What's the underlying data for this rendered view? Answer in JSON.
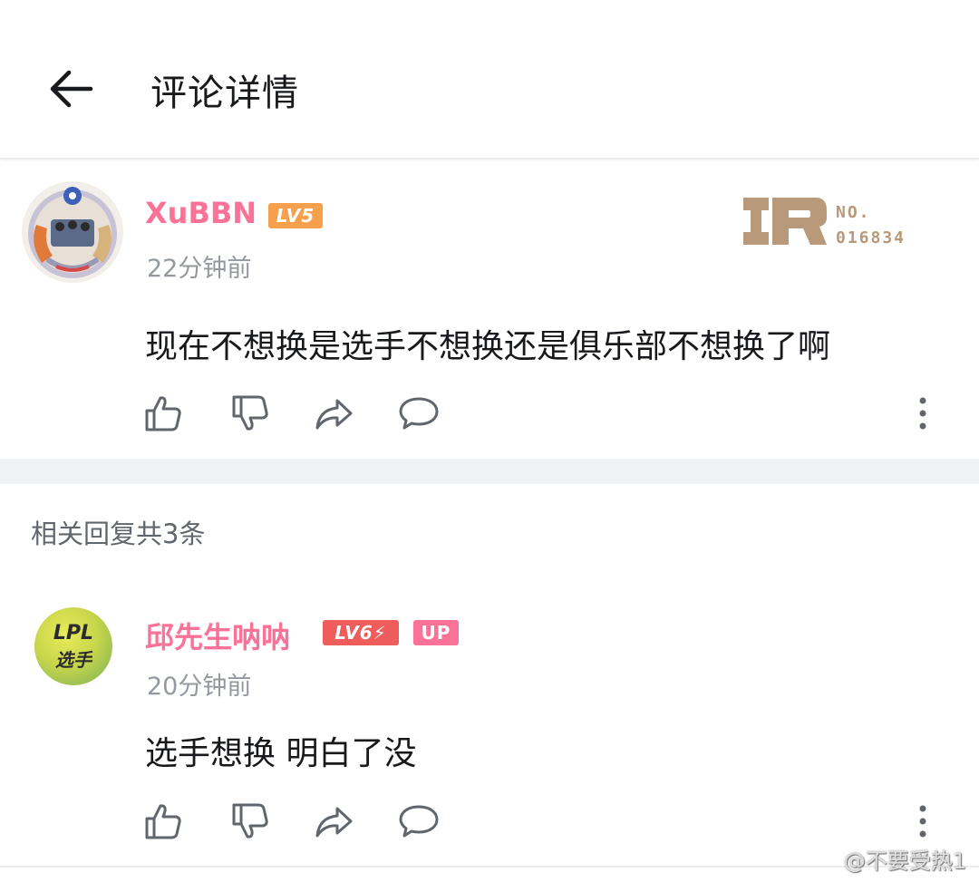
{
  "header": {
    "title": "评论详情"
  },
  "main_comment": {
    "username": "XuBBN",
    "level": "LV5",
    "time": "22分钟前",
    "content": "现在不想换是选手不想换还是俱乐部不想换了啊",
    "badge": {
      "no_label": "NO.",
      "number": "016834"
    }
  },
  "replies": {
    "header": "相关回复共3条",
    "items": [
      {
        "username": "邱先生呐呐",
        "level": "LV6",
        "up_tag": "UP",
        "avatar_text_top": "LPL",
        "avatar_text_bottom": "选手",
        "time": "20分钟前",
        "content": "选手想换 明白了没"
      }
    ]
  },
  "watermark": "@不要受热1",
  "colors": {
    "username": "#fb7299",
    "lv5": "#f6a04d",
    "lv6": "#ee5c5c",
    "up": "#fb7299",
    "badge": "#b89a7a"
  }
}
